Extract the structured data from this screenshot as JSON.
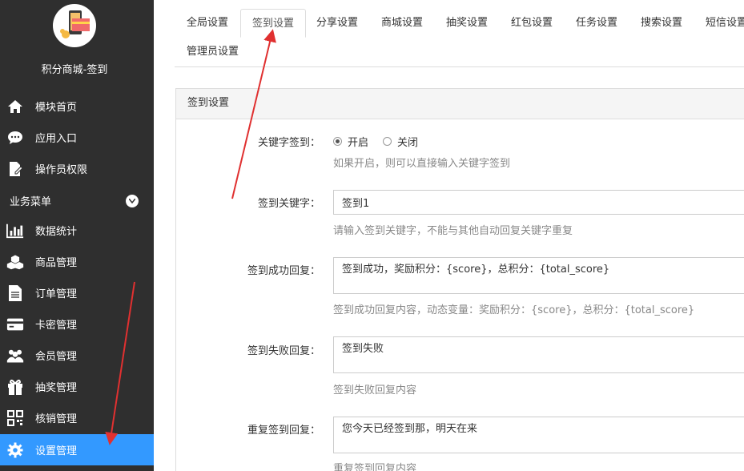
{
  "sidebar": {
    "app_title": "积分商城-签到",
    "top_items": [
      {
        "label": "模块首页",
        "icon": "home-icon"
      },
      {
        "label": "应用入口",
        "icon": "chat-bubble-icon"
      },
      {
        "label": "操作员权限",
        "icon": "edit-document-icon"
      }
    ],
    "section_title": "业务菜单",
    "items": [
      {
        "label": "数据统计",
        "icon": "bar-chart-icon"
      },
      {
        "label": "商品管理",
        "icon": "cubes-icon"
      },
      {
        "label": "订单管理",
        "icon": "document-icon"
      },
      {
        "label": "卡密管理",
        "icon": "credit-card-icon"
      },
      {
        "label": "会员管理",
        "icon": "users-icon"
      },
      {
        "label": "抽奖管理",
        "icon": "gift-icon"
      },
      {
        "label": "核销管理",
        "icon": "qrcode-icon"
      },
      {
        "label": "设置管理",
        "icon": "gear-icon"
      }
    ]
  },
  "tabs": [
    "全局设置",
    "签到设置",
    "分享设置",
    "商城设置",
    "抽奖设置",
    "红包设置",
    "任务设置",
    "搜索设置",
    "短信设置",
    "管理员设置"
  ],
  "panel": {
    "title": "签到设置",
    "keyword_sign": {
      "label": "关键字签到：",
      "option_on": "开启",
      "option_off": "关闭",
      "help": "如果开启，则可以直接输入关键字签到"
    },
    "sign_keyword": {
      "label": "签到关键字：",
      "value": "签到1",
      "help": "请输入签到关键字，不能与其他自动回复关键字重复"
    },
    "success_reply": {
      "label": "签到成功回复：",
      "value": "签到成功，奖励积分：{score}，总积分：{total_score}",
      "help": "签到成功回复内容，动态变量：奖励积分：{score}，总积分：{total_score}"
    },
    "fail_reply": {
      "label": "签到失败回复：",
      "value": "签到失败",
      "help": "签到失败回复内容"
    },
    "repeat_reply": {
      "label": "重复签到回复：",
      "value": "您今天已经签到那，明天在来",
      "help": "重复签到回复内容"
    }
  },
  "colors": {
    "sidebar_bg": "#2f2f2f",
    "active_bg": "#3399ff",
    "annotation_arrow": "#e03030"
  }
}
